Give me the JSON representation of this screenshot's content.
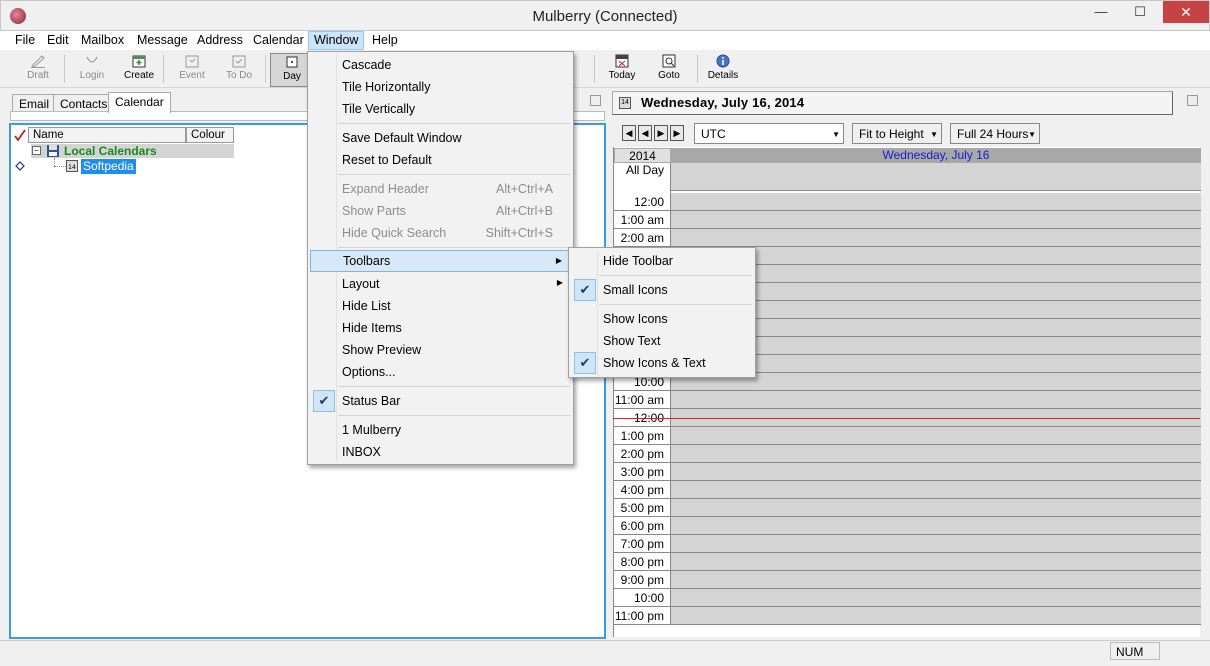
{
  "window": {
    "title": "Mulberry (Connected)"
  },
  "menubar": [
    "File",
    "Edit",
    "Mailbox",
    "Message",
    "Address",
    "Calendar",
    "Window",
    "Help"
  ],
  "toolbar": {
    "draft": "Draft",
    "login": "Login",
    "create": "Create",
    "event": "Event",
    "todo": "To Do",
    "day": "Day",
    "tasks_fragment": "ks",
    "today": "Today",
    "goto": "Goto",
    "details": "Details"
  },
  "left": {
    "tabs": [
      "Email",
      "Contacts",
      "Calendar"
    ],
    "columns": [
      "Name",
      "Colour"
    ],
    "local_calendars": "Local Calendars",
    "softpedia": "Softpedia"
  },
  "right": {
    "day_title": "Wednesday, July 16, 2014",
    "timezone": "UTC",
    "fit": "Fit to Height",
    "range": "Full 24 Hours",
    "year": "2014",
    "day_header": "Wednesday, July 16",
    "all_day": "All Day",
    "hours": [
      "12:00 am",
      "1:00 am",
      "2:00 am",
      "",
      "",
      "",
      "",
      "",
      "",
      "",
      "",
      "11:00 am",
      "12:00 pm",
      "1:00 pm",
      "2:00 pm",
      "3:00 pm",
      "4:00 pm",
      "5:00 pm",
      "6:00 pm",
      "7:00 pm",
      "8:00 pm",
      "9:00 pm",
      "10:00 pm",
      "11:00 pm"
    ],
    "hour_fragments": {
      "h3": "3:00",
      "h10": "10:00 am"
    }
  },
  "window_menu": {
    "items": [
      {
        "label": "Cascade"
      },
      {
        "label": "Tile Horizontally"
      },
      {
        "label": "Tile Vertically"
      },
      {
        "label": "Save Default Window"
      },
      {
        "label": "Reset to Default"
      },
      {
        "label": "Expand Header",
        "shortcut": "Alt+Ctrl+A"
      },
      {
        "label": "Show Parts",
        "shortcut": "Alt+Ctrl+B"
      },
      {
        "label": "Hide Quick Search",
        "shortcut": "Shift+Ctrl+S"
      },
      {
        "label": "Toolbars"
      },
      {
        "label": "Layout"
      },
      {
        "label": "Hide List"
      },
      {
        "label": "Hide Items"
      },
      {
        "label": "Show Preview"
      },
      {
        "label": "Options..."
      },
      {
        "label": "Status Bar"
      },
      {
        "label": "1 Mulberry"
      },
      {
        "label": "INBOX"
      }
    ]
  },
  "toolbars_submenu": {
    "items": [
      {
        "label": "Hide Toolbar"
      },
      {
        "label": "Small Icons"
      },
      {
        "label": "Show Icons"
      },
      {
        "label": "Show Text"
      },
      {
        "label": "Show Icons & Text"
      }
    ]
  },
  "statusbar": {
    "num": "NUM"
  },
  "icons": {
    "check": "✔",
    "submenu": "▶",
    "dropdown": "▼",
    "min": "—",
    "max": "☐",
    "close": "✕"
  }
}
